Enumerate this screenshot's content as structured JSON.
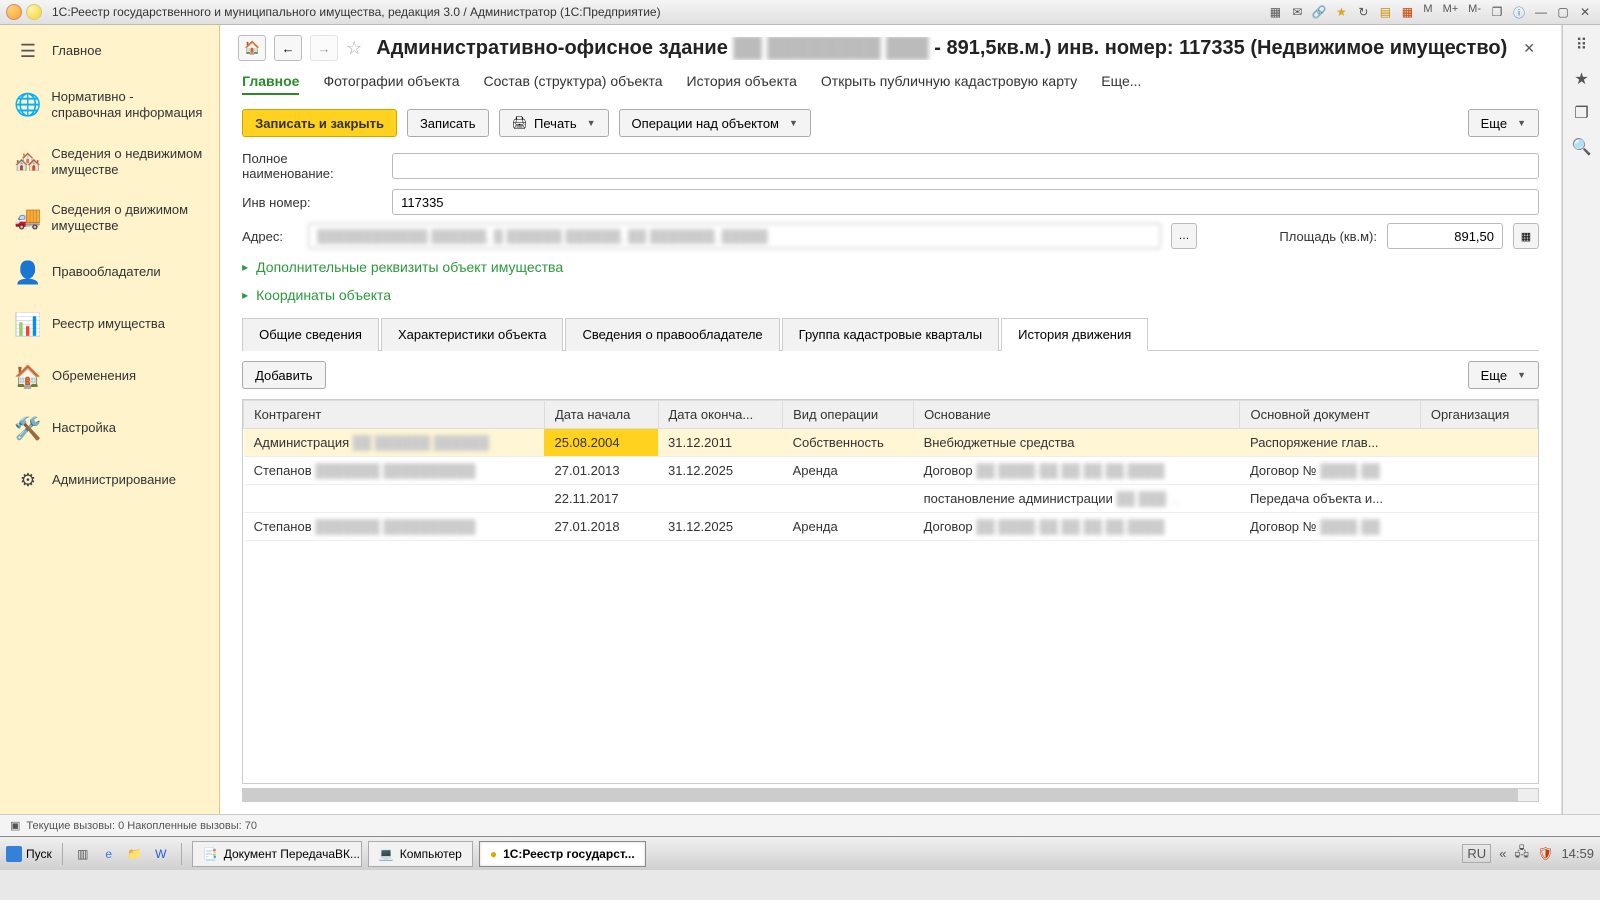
{
  "titlebar": {
    "app_title": "1С:Реестр государственного и муниципального имущества, редакция 3.0 / Администратор  (1С:Предприятие)",
    "m": "M",
    "m_plus": "M+",
    "m_minus": "M-"
  },
  "sidebar": {
    "items": [
      {
        "label": "Главное"
      },
      {
        "label": "Нормативно - справочная информация"
      },
      {
        "label": "Сведения о недвижимом имуществе"
      },
      {
        "label": "Сведения о движимом имуществе"
      },
      {
        "label": "Правообладатели"
      },
      {
        "label": "Реестр имущества"
      },
      {
        "label": "Обременения"
      },
      {
        "label": "Настройка"
      },
      {
        "label": "Администрирование"
      }
    ]
  },
  "header": {
    "title_prefix": "Административно-офисное здание",
    "title_blurred": "██ ████████ ███",
    "title_suffix": " - 891,5кв.м.) инв. номер: 117335 (Недвижимое имущество)"
  },
  "command_tabs": [
    "Главное",
    "Фотографии объекта",
    "Состав (структура) объекта",
    "История объекта",
    "Открыть публичную кадастровую карту",
    "Еще..."
  ],
  "toolbar": {
    "write_close": "Записать и закрыть",
    "write": "Записать",
    "print": "Печать",
    "ops": "Операции над объектом",
    "more": "Еще"
  },
  "form": {
    "full_name_label": "Полное наименование:",
    "full_name_value": "",
    "inv_label": "Инв номер:",
    "inv_value": "117335",
    "addr_label": "Адрес:",
    "addr_value": "████████████ ██████, █ ██████ ██████, ██ ███████, █████",
    "area_label": "Площадь (кв.м):",
    "area_value": "891,50"
  },
  "expanders": {
    "e1": "Дополнительные реквизиты объект имущества",
    "e2": "Координаты объекта"
  },
  "data_tabs": [
    "Общие сведения",
    "Характеристики объекта",
    "Сведения о правообладателе",
    "Группа кадастровые кварталы",
    "История движения"
  ],
  "add_btn": "Добавить",
  "more_btn": "Еще",
  "grid": {
    "headers": [
      "Контрагент",
      "Дата начала",
      "Дата оконча...",
      "Вид операции",
      "Основание",
      "Основной документ",
      "Организация"
    ],
    "rows": [
      {
        "c0": "Администрация ",
        "c0b": "██ ██████ ██████",
        "c1": "25.08.2004",
        "c2": "31.12.2011",
        "c3": "Собственность",
        "c4": "Внебюджетные средства",
        "c5": "Распоряжение глав...",
        "c6": "",
        "sel": true,
        "hl": true
      },
      {
        "c0": "Степанов ",
        "c0b": "███████ ██████████",
        "c1": "27.01.2013",
        "c2": "31.12.2025",
        "c3": "Аренда",
        "c4": "Договор ",
        "c4b": "██ ████-██ ██ ██.██.████",
        "c5": "Договор № ",
        "c5b": "████-██",
        "c6": ""
      },
      {
        "c0": "",
        "c1": "22.11.2017",
        "c2": "",
        "c3": "",
        "c4": "постановление администрации ",
        "c4b": "██ ███ ...",
        "c5": "Передача объекта и...",
        "c6": ""
      },
      {
        "c0": "Степанов ",
        "c0b": "███████ ██████████",
        "c1": "27.01.2018",
        "c2": "31.12.2025",
        "c3": "Аренда",
        "c4": "Договор ",
        "c4b": "██ ████-██ ██ ██.██.████",
        "c5": "Договор № ",
        "c5b": "████-██",
        "c6": ""
      }
    ]
  },
  "status": "Текущие вызовы: 0  Накопленные вызовы: 70",
  "taskbar": {
    "start": "Пуск",
    "items": [
      "Документ ПередачаВК...",
      "Компьютер",
      "1С:Реестр государст..."
    ],
    "lang": "RU",
    "time": "14:59"
  }
}
